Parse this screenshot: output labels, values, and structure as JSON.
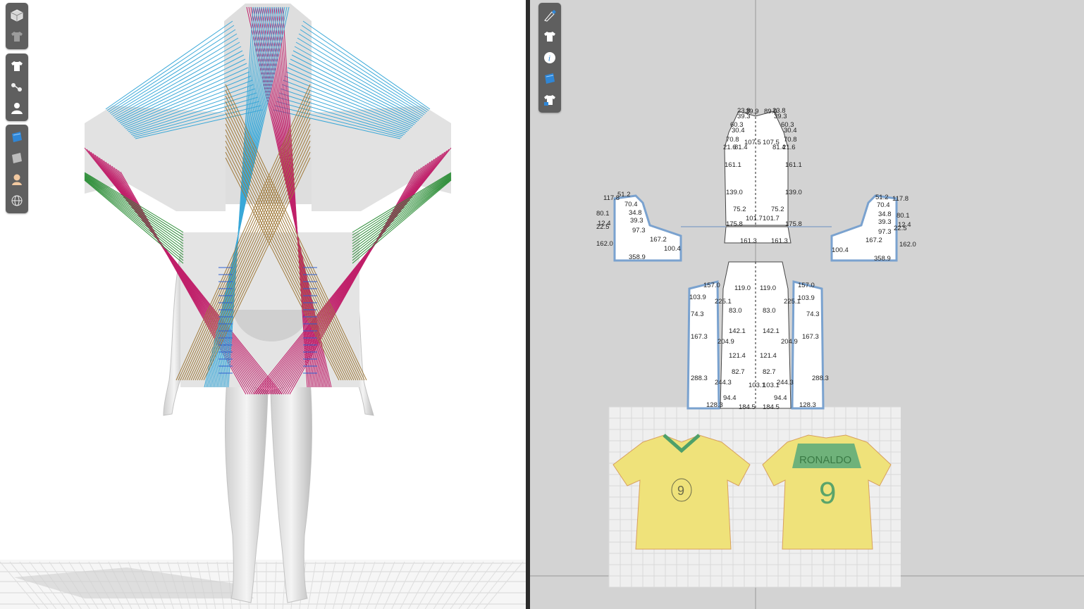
{
  "view3d": {
    "toolbar_groups": [
      [
        "cube-icon",
        "shirt-gray-icon"
      ],
      [
        "shirt-icon",
        "sewing-icon",
        "avatar-icon"
      ],
      [
        "fabric-icon",
        "fabric-dark-icon",
        "avatar-skin-icon",
        "globe-icon"
      ]
    ]
  },
  "view2d": {
    "toolbar": [
      "pen-icon",
      "shirt-icon",
      "info-icon",
      "fabric-icon",
      "lock-shirt-icon"
    ],
    "measurements": {
      "sleeve_left": [
        "117.8",
        "51.2",
        "70.4",
        "34.8",
        "80.1",
        "12.4",
        "22.5",
        "39.3",
        "97.3",
        "167.2",
        "162.0",
        "100.4",
        "358.9"
      ],
      "sleeve_right": [
        "51.2",
        "117.8",
        "70.4",
        "34.8",
        "80.1",
        "12.4",
        "22.5",
        "39.3",
        "97.3",
        "167.2",
        "100.4",
        "162.0",
        "358.9"
      ],
      "back": [
        "23.8",
        "39.9",
        "89.9",
        "23.8",
        "39.3",
        "39.3",
        "60.3",
        "60.3",
        "30.4",
        "30.4",
        "70.8",
        "70.8",
        "21.6",
        "21.6",
        "107.5",
        "107.5",
        "81.4",
        "81.4",
        "161.1",
        "161.1",
        "139.0",
        "139.0",
        "75.2",
        "75.2",
        "101.7",
        "101.7",
        "175.8",
        "175.8",
        "161.3",
        "161.3"
      ],
      "front": [
        "157.0",
        "157.0",
        "103.9",
        "103.9",
        "225.1",
        "225.1",
        "74.3",
        "74.3",
        "83.0",
        "83.0",
        "119.0",
        "119.0",
        "142.1",
        "142.1",
        "167.3",
        "167.3",
        "204.9",
        "204.9",
        "121.4",
        "121.4",
        "82.7",
        "82.7",
        "288.3",
        "288.3",
        "244.3",
        "244.3",
        "103.1",
        "103.1",
        "94.4",
        "94.4",
        "128.3",
        "128.3",
        "184.5",
        "184.5"
      ]
    },
    "reference_image": {
      "front_number": "9",
      "back_number": "9",
      "back_name": "RONALDO"
    }
  }
}
